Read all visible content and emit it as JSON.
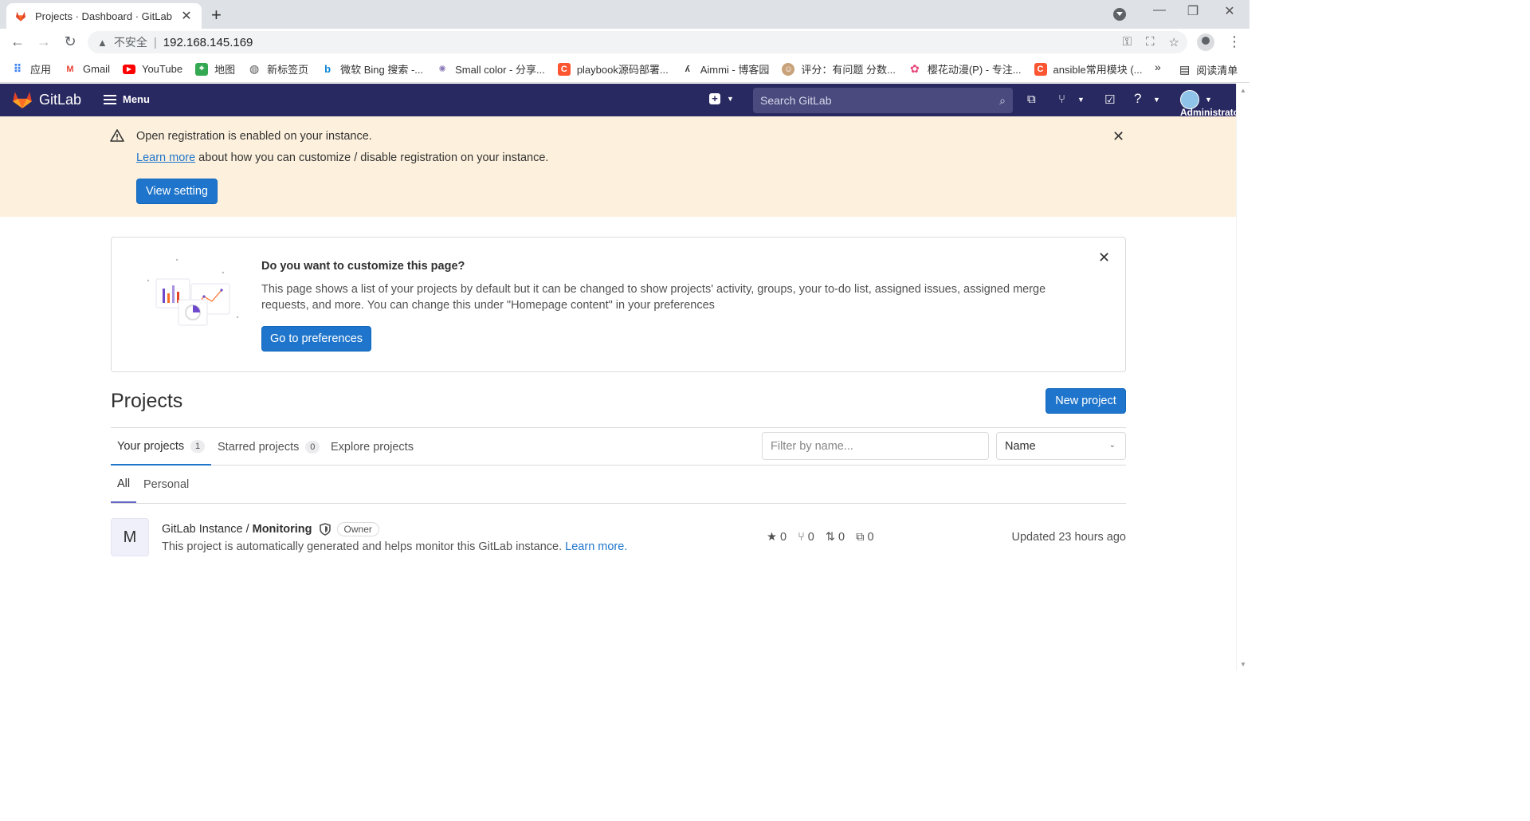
{
  "browser": {
    "tab_title": "Projects · Dashboard · GitLab",
    "insecure_label": "不安全",
    "url": "192.168.145.169",
    "bookmarks": [
      {
        "label": "应用",
        "icon": "apps-grid-icon"
      },
      {
        "label": "Gmail",
        "icon": "gmail-icon"
      },
      {
        "label": "YouTube",
        "icon": "youtube-icon"
      },
      {
        "label": "地图",
        "icon": "maps-icon"
      },
      {
        "label": "新标签页",
        "icon": "globe-icon"
      },
      {
        "label": "微软 Bing 搜索 -...",
        "icon": "bing-icon"
      },
      {
        "label": "Small color - 分享...",
        "icon": "site-icon"
      },
      {
        "label": "playbook源码部署...",
        "icon": "csdn-icon"
      },
      {
        "label": "Aimmi - 博客园",
        "icon": "blog-icon"
      },
      {
        "label": "评分：有问题 分数...",
        "icon": "avatar-icon"
      },
      {
        "label": "樱花动漫(P) - 专注...",
        "icon": "flower-icon"
      },
      {
        "label": "ansible常用模块 (...",
        "icon": "csdn-icon"
      }
    ],
    "more_label": "»",
    "reading_list": "阅读清单"
  },
  "gitlab_nav": {
    "brand": "GitLab",
    "menu_label": "Menu",
    "search_placeholder": "Search GitLab",
    "user_label": "Administrator"
  },
  "banner": {
    "title": "Open registration is enabled on your instance.",
    "link_text": "Learn more",
    "text_rest": " about how you can customize / disable registration on your instance.",
    "button": "View setting"
  },
  "customize_card": {
    "title": "Do you want to customize this page?",
    "text": "This page shows a list of your projects by default but it can be changed to show projects' activity, groups, your to-do list, assigned issues, assigned merge requests, and more. You can change this under \"Homepage content\" in your preferences",
    "button": "Go to preferences"
  },
  "projects": {
    "title": "Projects",
    "new_button": "New project",
    "tabs": [
      {
        "label": "Your projects",
        "count": "1"
      },
      {
        "label": "Starred projects",
        "count": "0"
      },
      {
        "label": "Explore projects"
      }
    ],
    "filter_placeholder": "Filter by name...",
    "sort_value": "Name",
    "subtabs": [
      "All",
      "Personal"
    ],
    "items": [
      {
        "avatar_letter": "M",
        "namespace": "GitLab Instance /",
        "name": "Monitoring",
        "role": "Owner",
        "description": "This project is automatically generated and helps monitor this GitLab instance.",
        "desc_link": "Learn more.",
        "stars": "0",
        "forks": "0",
        "merge_requests": "0",
        "issues": "0",
        "updated": "Updated 23 hours ago"
      }
    ]
  },
  "colors": {
    "nav_bg": "#292961",
    "banner_bg": "#fdf1dd",
    "primary": "#1f75cb",
    "tab_active": "#1f75cb",
    "subtab_active": "#6666c4"
  }
}
